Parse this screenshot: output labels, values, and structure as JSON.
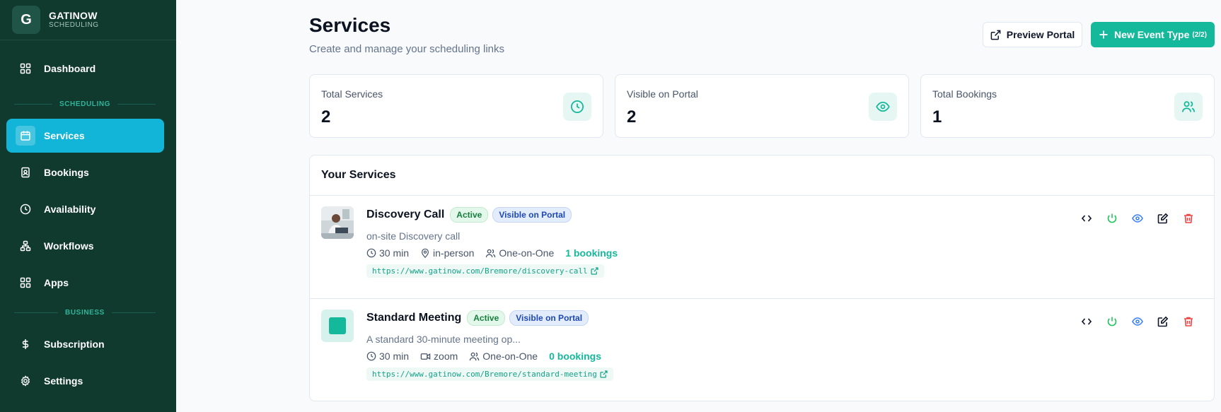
{
  "brand": {
    "initial": "G",
    "name": "GATINOW",
    "subtitle": "SCHEDULING"
  },
  "sidebar": {
    "items": [
      {
        "label": "Dashboard",
        "icon": "grid-icon"
      },
      {
        "label": "Services",
        "icon": "calendar-icon",
        "active": true
      },
      {
        "label": "Bookings",
        "icon": "contact-book-icon"
      },
      {
        "label": "Availability",
        "icon": "clock-icon"
      },
      {
        "label": "Workflows",
        "icon": "workflow-icon"
      },
      {
        "label": "Apps",
        "icon": "grid-icon"
      },
      {
        "label": "Subscription",
        "icon": "dollar-icon"
      },
      {
        "label": "Settings",
        "icon": "gear-icon"
      }
    ],
    "sections": {
      "scheduling": "SCHEDULING",
      "business": "BUSINESS"
    }
  },
  "header": {
    "title": "Services",
    "subtitle": "Create and manage your scheduling links",
    "preview_label": "Preview Portal",
    "new_label": "New Event Type",
    "new_count": "(2/2)"
  },
  "stats": [
    {
      "label": "Total Services",
      "value": "2",
      "icon": "clock-icon"
    },
    {
      "label": "Visible on Portal",
      "value": "2",
      "icon": "eye-icon"
    },
    {
      "label": "Total Bookings",
      "value": "1",
      "icon": "users-icon"
    }
  ],
  "services_section": {
    "title": "Your Services",
    "items": [
      {
        "name": "Discovery Call",
        "status": "Active",
        "visibility": "Visible on Portal",
        "description": "on-site Discovery call",
        "duration": "30 min",
        "location": "in-person",
        "type": "One-on-One",
        "bookings": "1 bookings",
        "url": "https://www.gatinow.com/Bremore/discovery-call",
        "location_icon": "map-pin-icon"
      },
      {
        "name": "Standard Meeting",
        "status": "Active",
        "visibility": "Visible on Portal",
        "description": "A standard 30-minute meeting op...",
        "duration": "30 min",
        "location": "zoom",
        "type": "One-on-One",
        "bookings": "0 bookings",
        "url": "https://www.gatinow.com/Bremore/standard-meeting",
        "location_icon": "video-icon"
      }
    ]
  },
  "colors": {
    "sidebar_bg": "#103a2e",
    "accent": "#14b89a",
    "active_nav": "#12b5d8",
    "danger": "#ef4444",
    "power": "#22c55e",
    "eye": "#3b82f6"
  }
}
